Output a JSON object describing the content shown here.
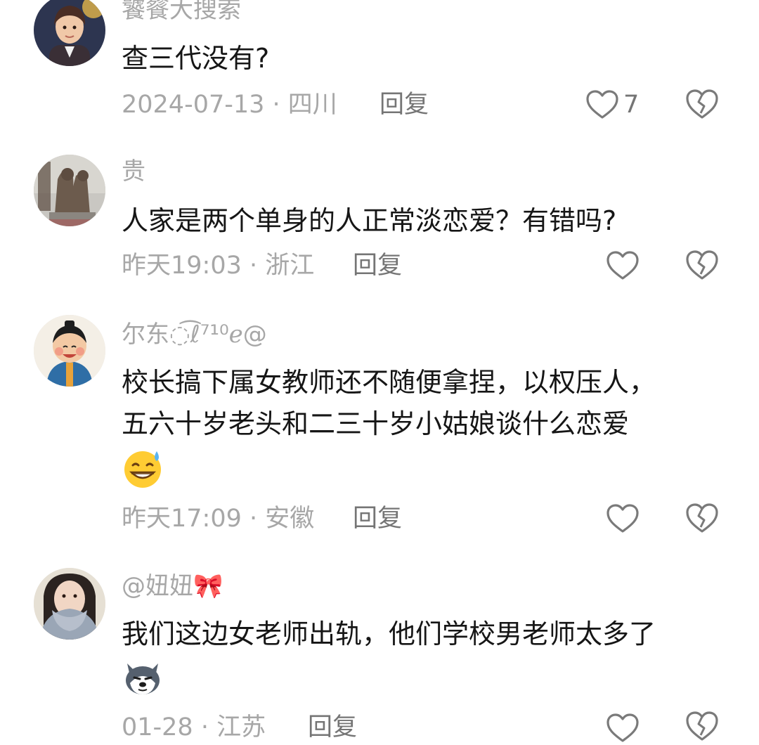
{
  "comments": [
    {
      "username": "饕餮大搜索",
      "text_lines": [
        "查三代没有?"
      ],
      "date": "2024-07-13",
      "location": "四川",
      "reply_label": "回复",
      "like_count": "7"
    },
    {
      "username": "贵",
      "text_lines": [
        "人家是两个单身的人正常淡恋爱？有错吗?"
      ],
      "date": "昨天19:03",
      "location": "浙江",
      "reply_label": "回复",
      "like_count": ""
    },
    {
      "username": "尔东◌͡ℓ⁷¹⁰ℯ@",
      "text_lines": [
        "校长搞下属女教师还不随便拿捏，以权压人，",
        "五六十岁老头和二三十岁小姑娘谈什么恋爱"
      ],
      "emoji": "sweat-grin-emoji",
      "date": "昨天17:09",
      "location": "安徽",
      "reply_label": "回复",
      "like_count": ""
    },
    {
      "username": "@妞妞🎀",
      "text_lines": [
        "我们这边女老师出轨，他们学校男老师太多了"
      ],
      "emoji": "husky-dog-emoji",
      "date": "01-28",
      "location": "江苏",
      "reply_label": "回复",
      "like_count": ""
    }
  ],
  "meta_separator": " · ",
  "colors": {
    "text": "#161616",
    "secondary": "#a7a7a7",
    "reply": "#757575",
    "icon_stroke": "#7a7a7a"
  }
}
